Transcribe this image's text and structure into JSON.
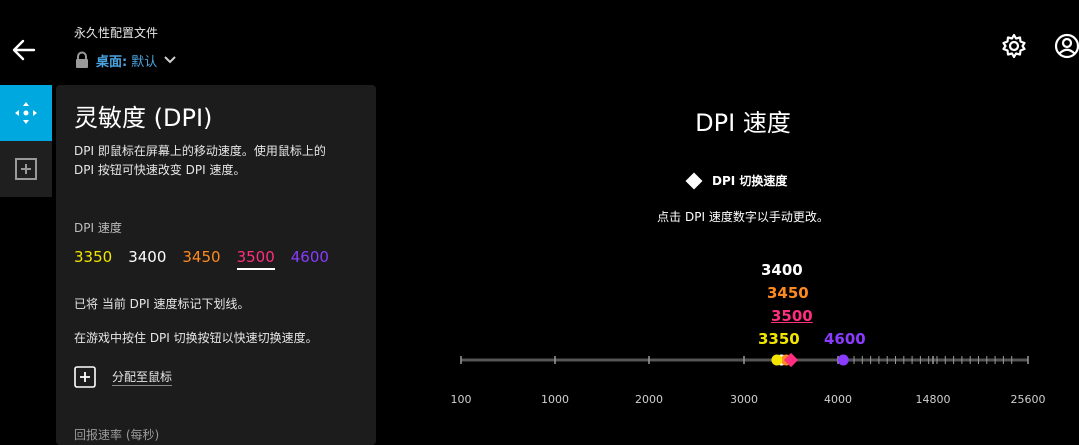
{
  "header": {
    "profile_title": "永久性配置文件",
    "profile_label": "桌面:",
    "profile_value": "默认"
  },
  "panel": {
    "title": "灵敏度 (DPI)",
    "desc_line1": "DPI 即鼠标在屏幕上的移动速度。使用鼠标上的",
    "desc_line2": "DPI 按钮可快速改变 DPI 速度。",
    "speeds_label": "DPI 速度",
    "speeds": [
      {
        "value": "3350",
        "color": "#f2e600"
      },
      {
        "value": "3400",
        "color": "#ffffff"
      },
      {
        "value": "3450",
        "color": "#ff8a1f"
      },
      {
        "value": "3500",
        "color": "#ff2e7e",
        "selected": true
      },
      {
        "value": "4600",
        "color": "#8a3bff"
      }
    ],
    "note1": "已将 当前 DPI 速度标记下划线。",
    "note2": "在游戏中按住 DPI 切换按钮以快速切换速度。",
    "assign_label": "分配至鼠标",
    "report_label": "回报速率 (每秒)"
  },
  "main": {
    "heading": "DPI 速度",
    "legend_label": "DPI 切换速度",
    "hint": "点击 DPI 速度数字以手动更改。"
  },
  "slider": {
    "min": 100,
    "max": 25600,
    "tick_labels": [
      "100",
      "1000",
      "2000",
      "3000",
      "4000",
      "14800",
      "25600"
    ],
    "markers": [
      {
        "value": "3400",
        "color": "#ffffff"
      },
      {
        "value": "3450",
        "color": "#ff8a1f"
      },
      {
        "value": "3500",
        "color": "#ff2e7e",
        "selected": true
      },
      {
        "value": "3350",
        "color": "#f2e600"
      },
      {
        "value": "4600",
        "color": "#8a3bff"
      }
    ]
  },
  "icons": {
    "back": "arrow-left-icon",
    "lock": "lock-icon",
    "chevron": "chevron-down-icon",
    "settings": "gear-icon",
    "account": "user-icon",
    "dpi_nav": "move-arrows-icon",
    "add": "plus-square-icon"
  }
}
